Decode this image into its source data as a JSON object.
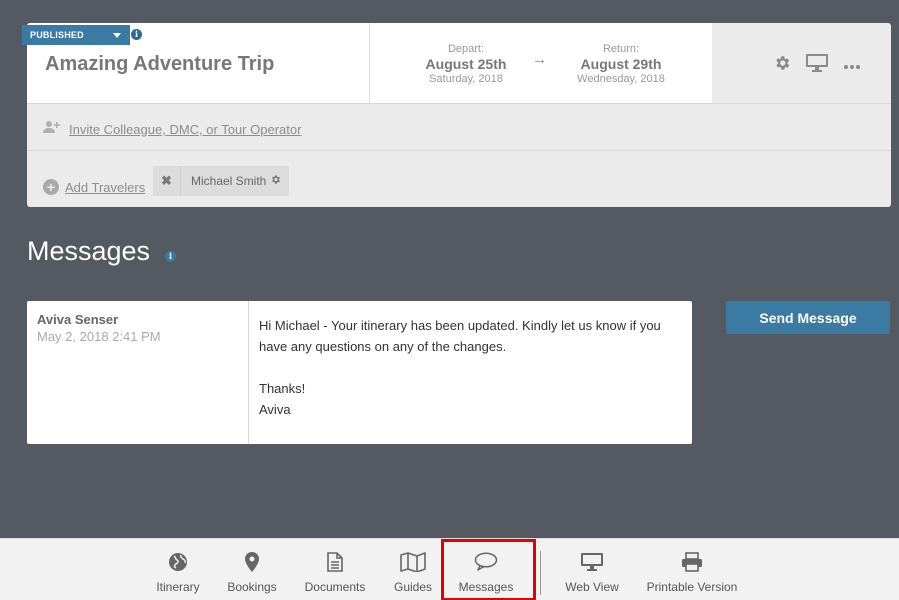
{
  "trip": {
    "status": "PUBLISHED",
    "title": "Amazing Adventure Trip",
    "depart_label": "Depart:",
    "depart_date": "August 25th",
    "depart_day": "Saturday, 2018",
    "return_label": "Return:",
    "return_date": "August 29th",
    "return_day": "Wednesday, 2018",
    "arrow": "→",
    "invite_label": "Invite Colleague, DMC, or Tour Operator",
    "add_travelers_label": "Add Travelers",
    "travelers": [
      {
        "name": "Michael Smith"
      }
    ]
  },
  "messages": {
    "title": "Messages",
    "items": [
      {
        "sender": "Aviva Senser",
        "time": "May 2, 2018 2:41 PM",
        "lines": [
          "Hi Michael - Your itinerary has been updated. Kindly let us know if you have any questions on any of the changes.",
          "",
          "Thanks!",
          "Aviva"
        ]
      }
    ],
    "send_button": "Send Message"
  },
  "nav": {
    "items": [
      {
        "label": "Itinerary",
        "icon": "globe-icon"
      },
      {
        "label": "Bookings",
        "icon": "map-pin-icon"
      },
      {
        "label": "Documents",
        "icon": "document-icon"
      },
      {
        "label": "Guides",
        "icon": "map-icon"
      },
      {
        "label": "Messages",
        "icon": "speech-bubble-icon"
      },
      {
        "label": "Web View",
        "icon": "monitor-icon"
      },
      {
        "label": "Printable Version",
        "icon": "printer-icon"
      }
    ],
    "active": "Messages"
  },
  "colors": {
    "background": "#555961",
    "accent": "#3a7aa3",
    "highlight": "#e30000"
  }
}
